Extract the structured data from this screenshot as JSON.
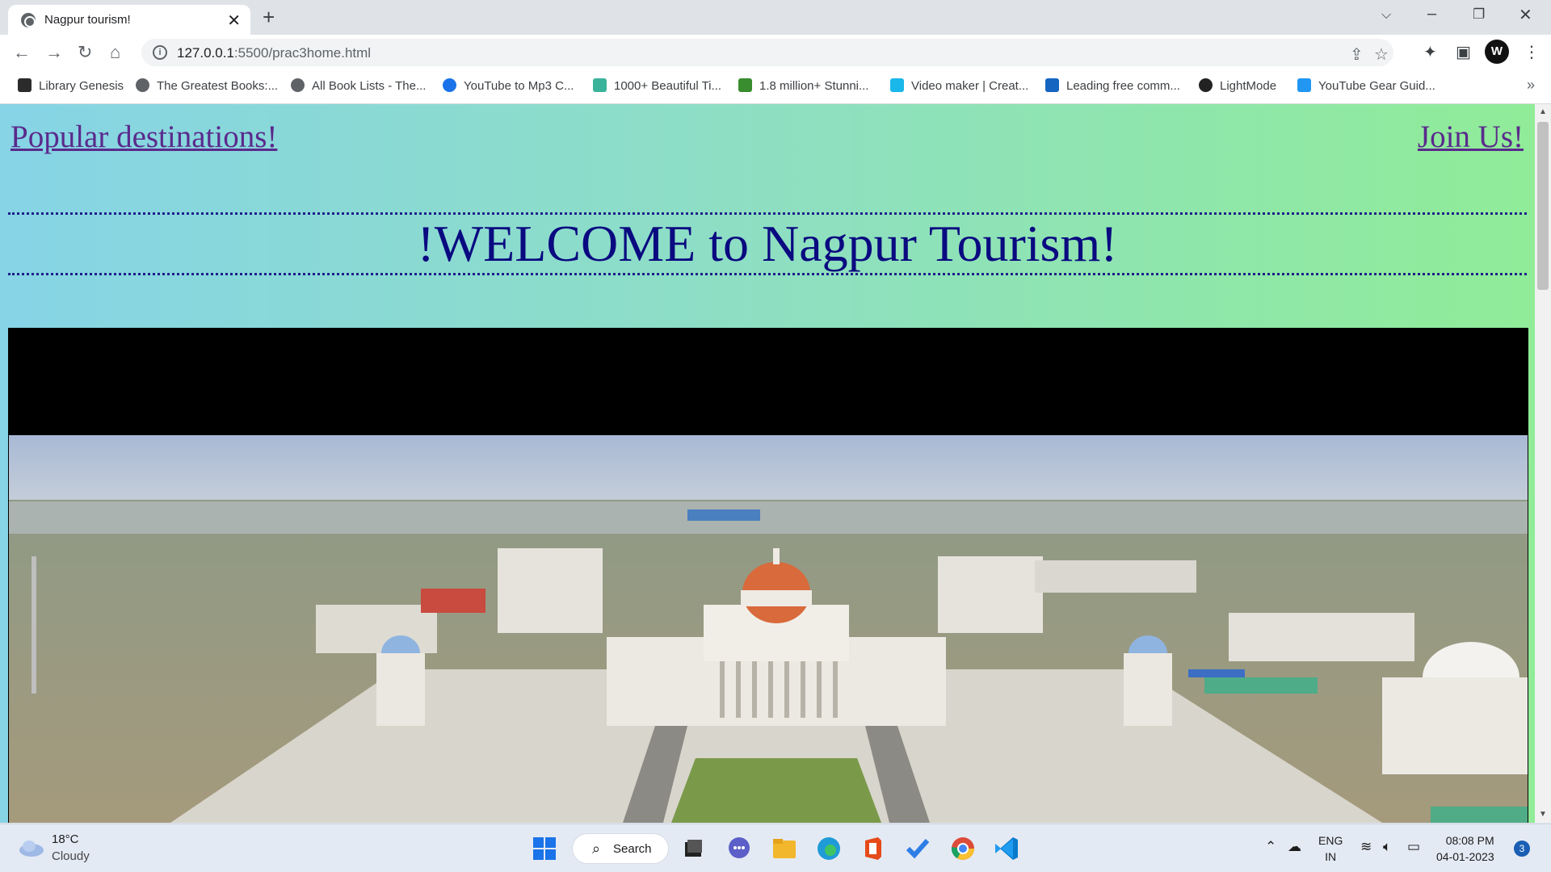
{
  "browser": {
    "tab_title": "Nagpur tourism!",
    "tab_close": "✕",
    "new_tab": "+",
    "url_host": "127.0.0.1",
    "url_path": ":5500/prac3home.html"
  },
  "bookmarks": [
    {
      "label": "Library Genesis",
      "color": "#2b2b2b"
    },
    {
      "label": "The Greatest Books:...",
      "color": "#3c4043"
    },
    {
      "label": "All Book Lists - The...",
      "color": "#3c4043"
    },
    {
      "label": "YouTube to Mp3 C...",
      "color": "#1a73e8"
    },
    {
      "label": "1000+ Beautiful Ti...",
      "color": "#3bb39b"
    },
    {
      "label": "1.8 million+ Stunni...",
      "color": "#3a8d2f"
    },
    {
      "label": "Video maker | Creat...",
      "color": "#1ab7ea"
    },
    {
      "label": "Leading free comm...",
      "color": "#1565c0"
    },
    {
      "label": "LightMode",
      "color": "#222"
    },
    {
      "label": "YouTube Gear Guid...",
      "color": "#2196f3"
    }
  ],
  "page": {
    "nav_left": "Popular destinations!",
    "nav_right": "Join Us!",
    "welcome": "!WELCOME to Nagpur Tourism!"
  },
  "taskbar": {
    "temperature": "18°C",
    "condition": "Cloudy",
    "search_label": "Search",
    "lang_line1": "ENG",
    "lang_line2": "IN",
    "time": "08:08 PM",
    "date": "04-01-2023",
    "notifications": "3"
  }
}
